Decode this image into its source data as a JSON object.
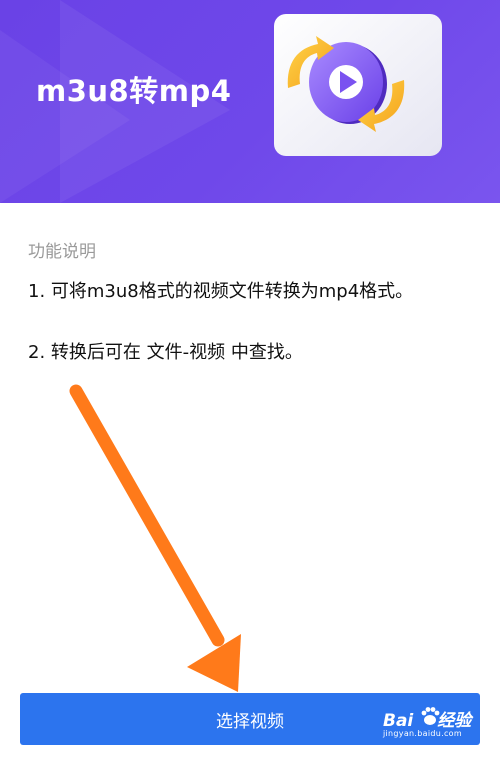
{
  "header": {
    "title": "m3u8转mp4"
  },
  "description": {
    "section_title": "功能说明",
    "items": [
      "1. 可将m3u8格式的视频文件转换为mp4格式。",
      "2. 转换后可在 文件-视频 中查找。"
    ]
  },
  "actions": {
    "select_video_label": "选择视频"
  },
  "watermark": {
    "brand_prefix": "Bai",
    "brand_suffix": "经验",
    "url": "jingyan.baidu.com"
  },
  "colors": {
    "header_background": "#6f48ea",
    "button_background": "#2c74ee",
    "annotation_arrow": "#ff7a1a"
  },
  "icons": {
    "hero_illustration": "video-convert-icon",
    "annotation": "arrow-annotation"
  }
}
